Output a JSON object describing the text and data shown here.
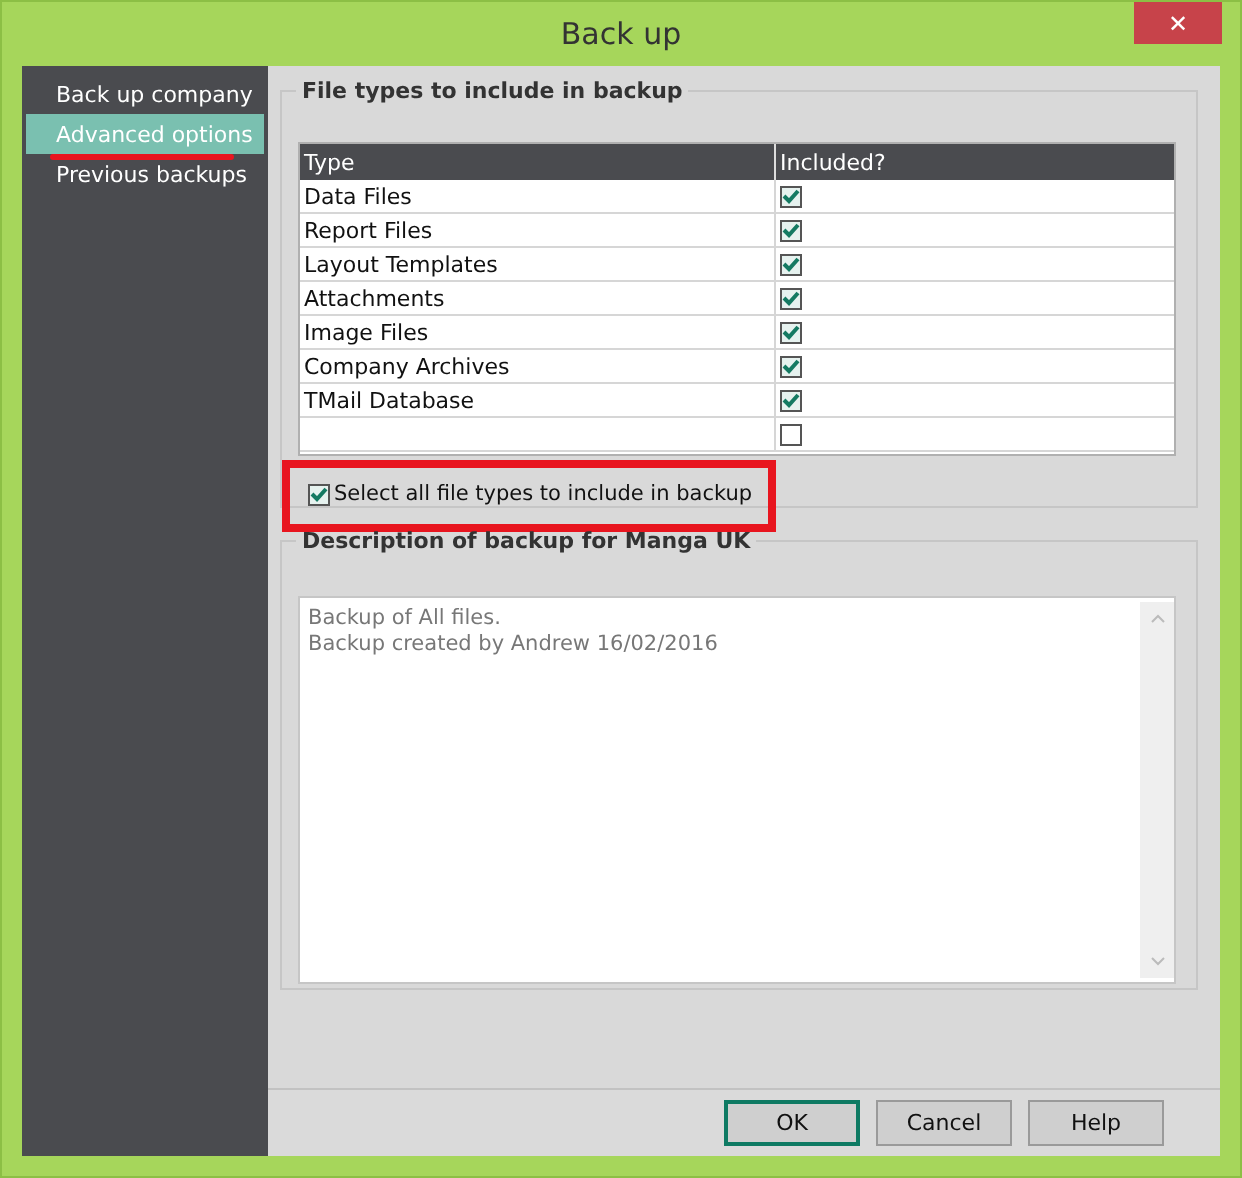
{
  "window": {
    "title": "Back up",
    "close_label": "✕"
  },
  "sidebar": {
    "items": [
      {
        "label": "Back up company",
        "selected": false,
        "highlighted": false
      },
      {
        "label": "Advanced options",
        "selected": true,
        "highlighted": true
      },
      {
        "label": "Previous backups",
        "selected": false,
        "highlighted": false
      }
    ]
  },
  "file_types": {
    "title": "File types to include in backup",
    "columns": [
      "Type",
      "Included?"
    ],
    "rows": [
      {
        "type": "Data Files",
        "included": true
      },
      {
        "type": "Report Files",
        "included": true
      },
      {
        "type": "Layout Templates",
        "included": true
      },
      {
        "type": "Attachments",
        "included": true
      },
      {
        "type": "Image Files",
        "included": true
      },
      {
        "type": "Company Archives",
        "included": true
      },
      {
        "type": "TMail Database",
        "included": true
      },
      {
        "included": false
      }
    ],
    "select_all": {
      "label": "Select all file types to include in backup",
      "checked": true,
      "highlighted": true
    }
  },
  "description": {
    "title": "Description of backup for Manga UK",
    "lines": [
      "Backup of All files.",
      "Backup created by Andrew 16/02/2016"
    ]
  },
  "buttons": [
    {
      "label": "OK",
      "default": true
    },
    {
      "label": "Cancel",
      "default": false
    },
    {
      "label": "Help",
      "default": false
    }
  ]
}
